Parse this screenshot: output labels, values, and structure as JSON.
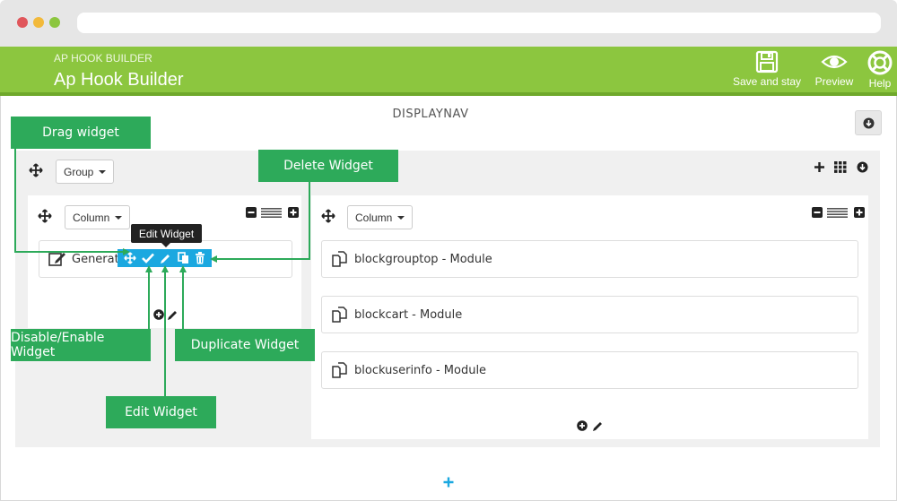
{
  "header": {
    "subtitle": "AP HOOK BUILDER",
    "title": "Ap Hook Builder",
    "save_label": "Save and stay",
    "preview_label": "Preview",
    "help_label": "Help"
  },
  "hook": {
    "name": "DISPLAYNAV"
  },
  "group": {
    "dropdown_label": "Group"
  },
  "columns": [
    {
      "dropdown_label": "Column",
      "widgets": [
        {
          "label": "Generat"
        }
      ]
    },
    {
      "dropdown_label": "Column",
      "widgets": [
        {
          "label": "blockgrouptop - Module"
        },
        {
          "label": "blockcart - Module"
        },
        {
          "label": "blockuserinfo - Module"
        }
      ]
    }
  ],
  "tooltip": {
    "text": "Edit Widget"
  },
  "callouts": {
    "drag": "Drag widget",
    "delete": "Delete Widget",
    "disable": "Disable/Enable Widget",
    "duplicate": "Duplicate Widget",
    "edit": "Edit Widget"
  },
  "colors": {
    "header_green": "#8cc63f",
    "callout_green": "#2daa5a",
    "toolbar_blue": "#1ba8e0",
    "add_blue": "#1ba8e0"
  },
  "icons": {
    "save": "floppy-disk-icon",
    "preview": "eye-icon",
    "help": "lifebuoy-icon",
    "move": "move-arrows-icon",
    "add": "plus-icon",
    "grid": "grid-icon",
    "collapse": "circle-arrow-down-icon"
  }
}
